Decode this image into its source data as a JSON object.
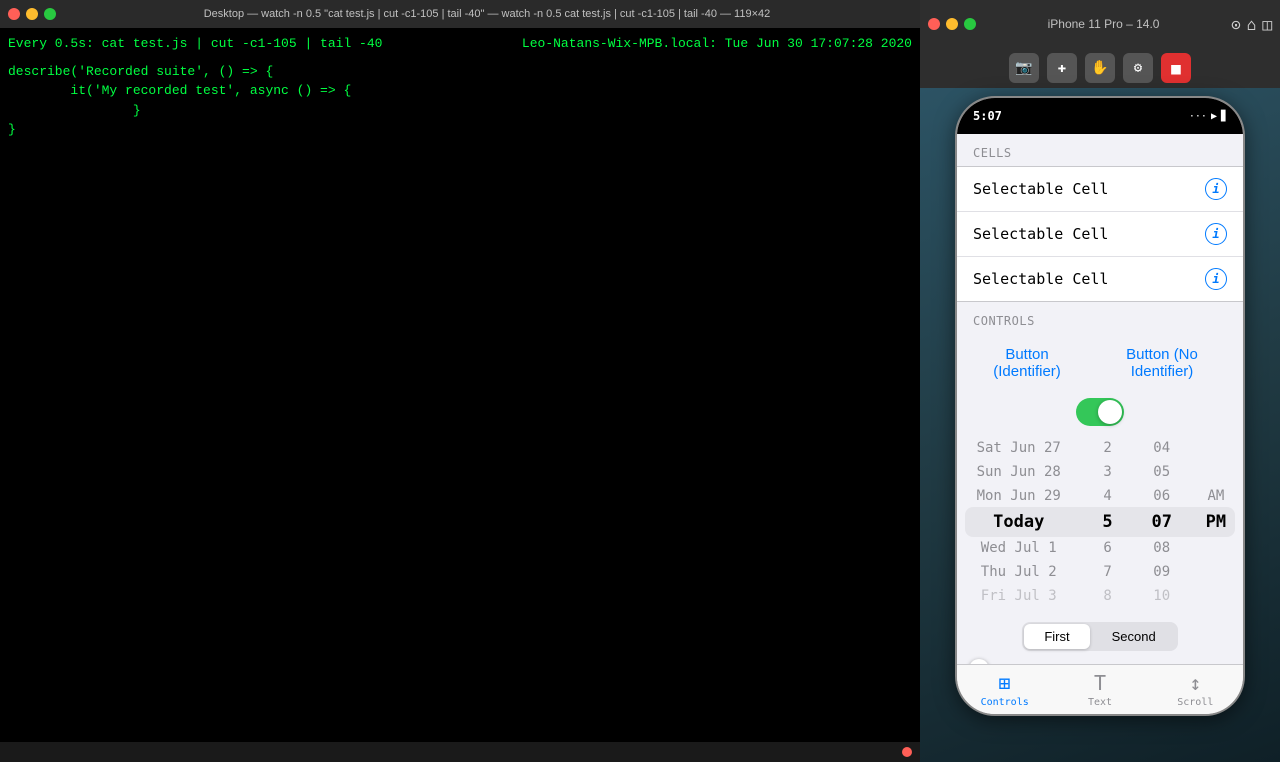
{
  "terminal": {
    "title": "Desktop — watch -n 0.5 \"cat test.js | cut -c1-105 | tail -40\" — watch -n 0.5 cat test.js | cut -c1-105 | tail -40 — 119×42",
    "header_left": "Every 0.5s: cat test.js | cut -c1-105 | tail -40",
    "header_right": "Leo-Natans-Wix-MPB.local: Tue Jun 30 17:07:28 2020",
    "code_lines": [
      "describe('Recorded suite', () => {",
      "        it('My recorded test', async () => {",
      "                }",
      "}"
    ]
  },
  "simulator": {
    "title": "iPhone 11 Pro – 14.0",
    "toolbar_buttons": [
      "camera-icon",
      "add-icon",
      "hand-icon",
      "settings-icon",
      "stop-icon"
    ],
    "iphone": {
      "status_time": "5:07",
      "status_right": "... ▶ ▊",
      "sections": {
        "cells_header": "CELLS",
        "cells": [
          {
            "label": "Selectable Cell"
          },
          {
            "label": "Selectable Cell"
          },
          {
            "label": "Selectable Cell"
          }
        ],
        "controls_header": "CONTROLS",
        "button_identifier": "Button (Identifier)",
        "button_no_identifier": "Button (No Identifier)",
        "toggle_on": true,
        "date_rows": [
          {
            "col1": "Sat Jun 27",
            "col2": "2",
            "col3": "04"
          },
          {
            "col1": "Sun Jun 28",
            "col2": "3",
            "col3": "05"
          },
          {
            "col1": "Mon Jun 29",
            "col2": "4",
            "col3": "06",
            "col4": "AM"
          },
          {
            "col1": "Today",
            "col2": "5",
            "col3": "07",
            "col4": "PM",
            "selected": true
          },
          {
            "col1": "Wed Jul 1",
            "col2": "6",
            "col3": "08"
          },
          {
            "col1": "Thu Jul 2",
            "col2": "7",
            "col3": "09"
          },
          {
            "col1": "Fri Jul 3",
            "col2": "8",
            "col3": "10"
          }
        ],
        "seg_first": "First",
        "seg_second": "Second",
        "tabs": [
          {
            "label": "Controls",
            "active": true
          },
          {
            "label": "Text",
            "active": false
          },
          {
            "label": "Scroll",
            "active": false
          }
        ]
      }
    }
  }
}
